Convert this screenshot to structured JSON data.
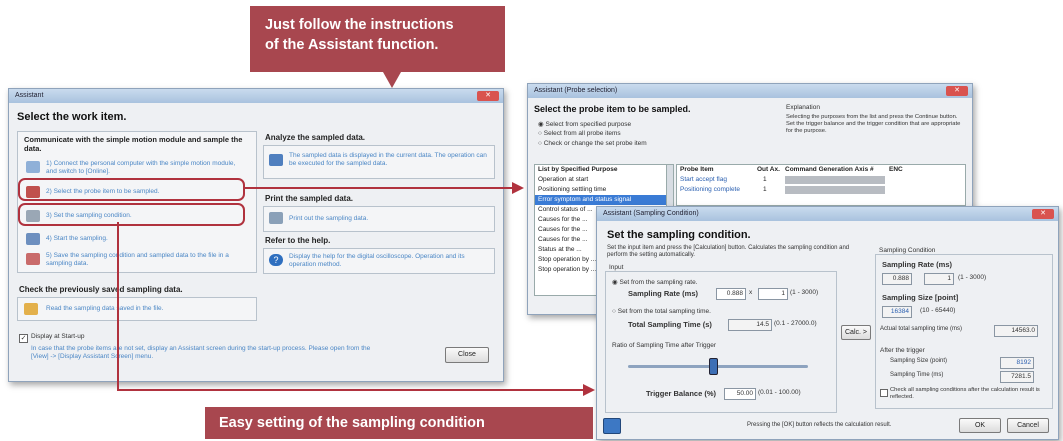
{
  "callout_top": {
    "line1": "Just follow the instructions",
    "line2": "of the Assistant function."
  },
  "callout_bottom": {
    "text": "Easy setting of the sampling condition"
  },
  "assistant": {
    "title": "Assistant",
    "heading": "Select the work item.",
    "communicate": {
      "title": "Communicate with the simple motion module and sample the data.",
      "step1": "1) Connect the personal computer with the simple motion module, and switch to [Online].",
      "step2": "2) Select the probe item to be sampled.",
      "step3": "3) Set the sampling condition.",
      "step4": "4) Start the sampling.",
      "step5": "5) Save the sampling condition and sampled data to the file in a sampling data."
    },
    "analyze": {
      "title": "Analyze the sampled data.",
      "text": "The sampled data is displayed in the current data. The operation can be executed for the sampled data."
    },
    "print": {
      "title": "Print the sampled data.",
      "text": "Print out the sampling data."
    },
    "help": {
      "title": "Refer to the help.",
      "text": "Display the help for the digital oscilloscope. Operation and its operation method."
    },
    "check": {
      "title": "Check the previously saved sampling data.",
      "text": "Read the sampling data saved in the file."
    },
    "display_at_startup": "Display at Start-up",
    "footer_note": "In case that the probe items are not set, display an Assistant screen during the start-up process. Please open from the [View] -> [Display Assistant Screen] menu.",
    "close_button": "Close"
  },
  "probe": {
    "title": "Assistant (Probe selection)",
    "heading": "Select the probe item to be sampled.",
    "radios": [
      "Select from specified purpose",
      "Select from all probe items",
      "Check or change the set probe item"
    ],
    "explanation_title": "Explanation",
    "explanation": "Selecting the purposes from the list and press the Continue button. Set the trigger balance and the trigger condition that are appropriate for the purpose.",
    "list_header": "List by Specified Purpose",
    "purposes": [
      "Operation at start",
      "Positioning settling time",
      "Error symptom and status signal",
      "Control status of ...",
      "Causes for the ...",
      "Causes for the ...",
      "Causes for the ...",
      "Status at the ...",
      "Stop operation by ...",
      "Stop operation by ..."
    ],
    "columns": [
      "Probe Item",
      "Out Ax.",
      "Command Generation Axis #",
      "ENC"
    ],
    "items": [
      {
        "name": "Start accept flag",
        "axis": "1"
      },
      {
        "name": "Positioning complete",
        "axis": "1"
      },
      {
        "name": "In-position",
        "axis": "1"
      }
    ]
  },
  "sampling": {
    "title": "Assistant (Sampling Condition)",
    "heading": "Set the sampling condition.",
    "desc": "Set the input item and press the [Calculation] button. Calculates the sampling condition and perform the setting automatically.",
    "input_label": "Input",
    "set_from_rate": "Set from the sampling rate.",
    "rate_label": "Sampling Rate (ms)",
    "rate_value": "0.888",
    "rate_mult": "x",
    "rate_factor": "1",
    "rate_range": "(1 - 3000)",
    "set_from_time": "Set from the total sampling time.",
    "total_time_label": "Total Sampling Time (s)",
    "total_time_value": "14.5",
    "total_time_range": "(0.1 - 27000.0)",
    "calc_button": "Calc. >",
    "ratio_label": "Ratio of Sampling Time after Trigger",
    "trigger_label": "Trigger Balance (%)",
    "trigger_value": "50.00",
    "trigger_range": "(0.01 - 100.00)",
    "cond_title": "Sampling Condition",
    "cond_rate_label": "Sampling Rate (ms)",
    "cond_rate_value": "0.888",
    "cond_rate_factor": "1",
    "cond_rate_range": "(1 - 3000)",
    "cond_size_label": "Sampling Size [point]",
    "cond_size_value": "16384",
    "cond_size_range": "(10 - 65440)",
    "actual_time_label": "Actual total sampling time (ms)",
    "actual_time_value": "14563.0",
    "after_trigger": "After the trigger",
    "size_point_label": "Sampling Size (point)",
    "size_point_value": "8192",
    "time_ms_label": "Sampling Time (ms)",
    "time_ms_value": "7281.5",
    "check_all": "Check all sampling conditions after the calculation result is reflected.",
    "footer_text": "Pressing the [OK] button reflects the calculation result.",
    "ok": "OK",
    "cancel": "Cancel"
  }
}
